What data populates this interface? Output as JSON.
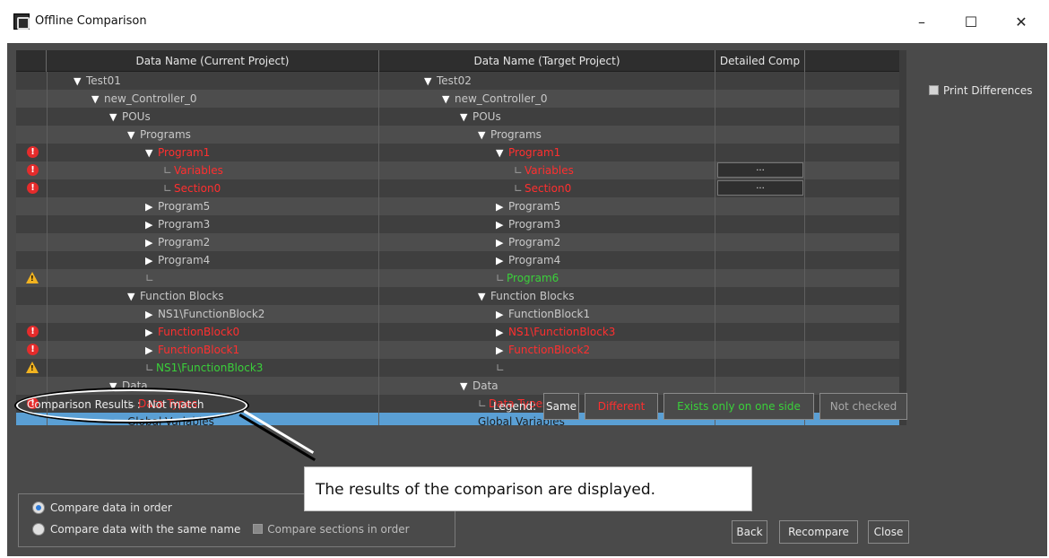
{
  "window": {
    "title": "Offline Comparison",
    "minimize": "–",
    "maximize": "☐",
    "close": "✕"
  },
  "grid": {
    "headers": {
      "current": "Data Name (Current Project)",
      "target": "Data Name (Target Project)",
      "detail": "Detailed Comp"
    },
    "rows": [
      {
        "status": "none",
        "cur": "Test01",
        "cur_level": 0,
        "cur_exp": "down",
        "cur_style": "norm",
        "tgt": "Test02",
        "tgt_level": 0,
        "tgt_exp": "down",
        "tgt_style": "norm",
        "detail": ""
      },
      {
        "status": "none",
        "cur": "new_Controller_0",
        "cur_level": 1,
        "cur_exp": "down",
        "cur_style": "norm",
        "tgt": "new_Controller_0",
        "tgt_level": 1,
        "tgt_exp": "down",
        "tgt_style": "norm",
        "detail": ""
      },
      {
        "status": "none",
        "cur": "POUs",
        "cur_level": 2,
        "cur_exp": "down",
        "cur_style": "norm",
        "tgt": "POUs",
        "tgt_level": 2,
        "tgt_exp": "down",
        "tgt_style": "norm",
        "detail": ""
      },
      {
        "status": "none",
        "cur": "Programs",
        "cur_level": 3,
        "cur_exp": "down",
        "cur_style": "norm",
        "tgt": "Programs",
        "tgt_level": 3,
        "tgt_exp": "down",
        "tgt_style": "norm",
        "detail": ""
      },
      {
        "status": "error",
        "cur": "Program1",
        "cur_level": 4,
        "cur_exp": "down",
        "cur_style": "diff",
        "tgt": "Program1",
        "tgt_level": 4,
        "tgt_exp": "down",
        "tgt_style": "diff",
        "detail": ""
      },
      {
        "status": "error",
        "cur": "Variables",
        "cur_level": 5,
        "cur_exp": "leaf",
        "cur_style": "diff",
        "tgt": "Variables",
        "tgt_level": 5,
        "tgt_exp": "leaf",
        "tgt_style": "diff",
        "detail": "..."
      },
      {
        "status": "error",
        "cur": "Section0",
        "cur_level": 5,
        "cur_exp": "leaf",
        "cur_style": "diff",
        "tgt": "Section0",
        "tgt_level": 5,
        "tgt_exp": "leaf",
        "tgt_style": "diff",
        "detail": "..."
      },
      {
        "status": "none",
        "cur": "Program5",
        "cur_level": 4,
        "cur_exp": "right",
        "cur_style": "norm",
        "tgt": "Program5",
        "tgt_level": 4,
        "tgt_exp": "right",
        "tgt_style": "norm",
        "detail": ""
      },
      {
        "status": "none",
        "cur": "Program3",
        "cur_level": 4,
        "cur_exp": "right",
        "cur_style": "norm",
        "tgt": "Program3",
        "tgt_level": 4,
        "tgt_exp": "right",
        "tgt_style": "norm",
        "detail": ""
      },
      {
        "status": "none",
        "cur": "Program2",
        "cur_level": 4,
        "cur_exp": "right",
        "cur_style": "norm",
        "tgt": "Program2",
        "tgt_level": 4,
        "tgt_exp": "right",
        "tgt_style": "norm",
        "detail": ""
      },
      {
        "status": "none",
        "cur": "Program4",
        "cur_level": 4,
        "cur_exp": "right",
        "cur_style": "norm",
        "tgt": "Program4",
        "tgt_level": 4,
        "tgt_exp": "right",
        "tgt_style": "norm",
        "detail": ""
      },
      {
        "status": "warn",
        "cur": "",
        "cur_level": 4,
        "cur_exp": "leaf",
        "cur_style": "norm",
        "tgt": "Program6",
        "tgt_level": 4,
        "tgt_exp": "leaf",
        "tgt_style": "only",
        "detail": ""
      },
      {
        "status": "none",
        "cur": "Function Blocks",
        "cur_level": 3,
        "cur_exp": "down",
        "cur_style": "norm",
        "tgt": "Function Blocks",
        "tgt_level": 3,
        "tgt_exp": "down",
        "tgt_style": "norm",
        "detail": ""
      },
      {
        "status": "none",
        "cur": "NS1\\FunctionBlock2",
        "cur_level": 4,
        "cur_exp": "right",
        "cur_style": "norm",
        "tgt": "FunctionBlock1",
        "tgt_level": 4,
        "tgt_exp": "right",
        "tgt_style": "norm",
        "detail": ""
      },
      {
        "status": "error",
        "cur": "FunctionBlock0",
        "cur_level": 4,
        "cur_exp": "right",
        "cur_style": "diff",
        "tgt": "NS1\\FunctionBlock3",
        "tgt_level": 4,
        "tgt_exp": "right",
        "tgt_style": "diff",
        "detail": ""
      },
      {
        "status": "error",
        "cur": "FunctionBlock1",
        "cur_level": 4,
        "cur_exp": "right",
        "cur_style": "diff",
        "tgt": "FunctionBlock2",
        "tgt_level": 4,
        "tgt_exp": "right",
        "tgt_style": "diff",
        "detail": ""
      },
      {
        "status": "warn",
        "cur": "NS1\\FunctionBlock3",
        "cur_level": 4,
        "cur_exp": "leaf",
        "cur_style": "only",
        "tgt": "",
        "tgt_level": 4,
        "tgt_exp": "leaf",
        "tgt_style": "norm",
        "detail": ""
      },
      {
        "status": "none",
        "cur": "Data",
        "cur_level": 2,
        "cur_exp": "down",
        "cur_style": "norm",
        "tgt": "Data",
        "tgt_level": 2,
        "tgt_exp": "down",
        "tgt_style": "norm",
        "detail": ""
      },
      {
        "status": "error",
        "cur": "Data Types",
        "cur_level": 3,
        "cur_exp": "leaf",
        "cur_style": "diff",
        "tgt": "Data Types",
        "tgt_level": 3,
        "tgt_exp": "leaf",
        "tgt_style": "diff",
        "detail": "..."
      },
      {
        "status": "none",
        "cur": "Global Variables",
        "cur_level": 3,
        "cur_exp": "none",
        "cur_style": "sel",
        "tgt": "Global Variables",
        "tgt_level": 3,
        "tgt_exp": "none",
        "tgt_style": "sel",
        "detail": "",
        "selected": true
      }
    ]
  },
  "options": {
    "print_differences": "Print Differences"
  },
  "results": {
    "label": "Comparison Results :",
    "value": "Not match"
  },
  "legend": {
    "label": "Legend:",
    "same": "Same",
    "different": "Different",
    "exists_one_side": "Exists only on one side",
    "not_checked": "Not checked"
  },
  "callout": {
    "text": "The results of the comparison are displayed."
  },
  "compare_mode": {
    "in_order": "Compare data in order",
    "same_name": "Compare data with the same name",
    "sections_in_order": "Compare sections in order"
  },
  "buttons": {
    "back": "Back",
    "recompare": "Recompare",
    "close": "Close"
  },
  "colors": {
    "different": "#ff2f2f",
    "only_one_side": "#3ad03a",
    "selected": "#5a9fd4"
  }
}
